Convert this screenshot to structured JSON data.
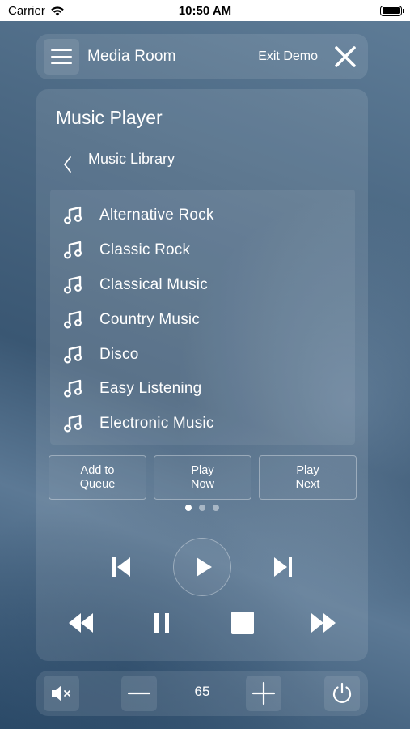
{
  "status_bar": {
    "carrier": "Carrier",
    "time": "10:50 AM",
    "icons": [
      "wifi-icon",
      "battery-icon"
    ]
  },
  "header": {
    "title": "Media Room",
    "exit_label": "Exit Demo",
    "icons": [
      "menu-icon",
      "close-icon"
    ]
  },
  "player": {
    "title": "Music Player",
    "breadcrumb": "Music Library",
    "items": [
      {
        "label": "Alternative Rock",
        "icon": "music-note-icon"
      },
      {
        "label": "Classic Rock",
        "icon": "music-note-icon"
      },
      {
        "label": "Classical Music",
        "icon": "music-note-icon"
      },
      {
        "label": "Country Music",
        "icon": "music-note-icon"
      },
      {
        "label": "Disco",
        "icon": "music-note-icon"
      },
      {
        "label": "Easy Listening",
        "icon": "music-note-icon"
      },
      {
        "label": "Electronic Music",
        "icon": "music-note-icon"
      }
    ],
    "actions": [
      {
        "label": "Add to\nQueue"
      },
      {
        "label": "Play\nNow"
      },
      {
        "label": "Play\nNext"
      }
    ],
    "pagination": {
      "pages": 3,
      "current": 1
    },
    "transport_icons": [
      "skip-previous-icon",
      "play-icon",
      "skip-next-icon",
      "rewind-icon",
      "pause-icon",
      "stop-icon",
      "fast-forward-icon"
    ]
  },
  "footer": {
    "volume": "65",
    "icons": [
      "mute-icon",
      "volume-down-icon",
      "volume-up-icon",
      "power-icon"
    ]
  },
  "colors": {
    "text": "#ffffff",
    "status_bar_bg": "#ffffff",
    "background_dark": "#2b4a68",
    "background_light": "#5f7d98"
  }
}
